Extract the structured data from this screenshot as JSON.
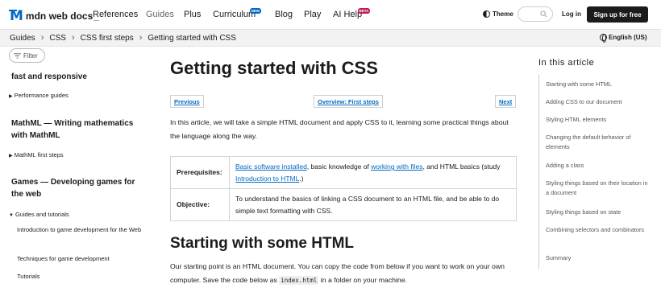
{
  "header": {
    "logo_mark": "M",
    "logo_text": "mdn web docs",
    "logo_underscore": "_",
    "nav": {
      "references": "References",
      "guides": "Guides",
      "plus": "Plus",
      "curriculum": "Curriculum",
      "curriculum_badge": "NEW",
      "blog": "Blog",
      "play": "Play",
      "ai_help": "AI Help",
      "ai_help_badge": "BETA"
    },
    "theme_label": "Theme",
    "login_label": "Log in",
    "signup_label": "Sign up for free"
  },
  "breadcrumb": {
    "items": [
      "Guides",
      "CSS",
      "CSS first steps",
      "Getting started with CSS"
    ],
    "separator": "›",
    "language": "English (US)"
  },
  "sidebar": {
    "filter_placeholder": "Filter",
    "sections": {
      "perf_tail": "fast and responsive",
      "perf_item": "Performance guides",
      "mathml": "MathML — Writing mathematics with MathML",
      "mathml_item": "MathML first steps",
      "games": "Games — Developing games for the web",
      "games_item": "Guides and tutorials",
      "games_sub1": "Introduction to game development for the Web",
      "games_sub2": "Techniques for game development",
      "games_sub3": "Tutorials"
    }
  },
  "main": {
    "title": "Getting started with CSS",
    "prev_label": "Previous",
    "overview_label": "Overview: First steps",
    "next_label": "Next",
    "intro": "In this article, we will take a simple HTML document and apply CSS to it, learning some practical things about the language along the way.",
    "prereq_label": "Prerequisites:",
    "prereq_link1": "Basic software installed",
    "prereq_text1": ", basic knowledge of ",
    "prereq_link2": "working with files",
    "prereq_text2": ", and HTML basics (study ",
    "prereq_link3": "Introduction to HTML",
    "prereq_text3": ".)",
    "objective_label": "Objective:",
    "objective_text": "To understand the basics of linking a CSS document to an HTML file, and be able to do simple text formatting with CSS.",
    "h2": "Starting with some HTML",
    "para2_a": "Our starting point is an HTML document. You can copy the code from below if you want to work on your own computer. Save the code below as ",
    "para2_code": "index.html",
    "para2_b": " in a folder on your machine."
  },
  "toc": {
    "title": "In this article",
    "items": [
      "Starting with some HTML",
      "Adding CSS to our document",
      "Styling HTML elements",
      "Changing the default behavior of elements",
      "Adding a class",
      "Styling things based on their location in a document",
      "Styling things based on state",
      "Combining selectors and combinators",
      "Summary"
    ]
  },
  "colors": {
    "brand_blue": "#0069c2",
    "text": "#1b1b1b",
    "beta_badge": "#c2185b"
  }
}
